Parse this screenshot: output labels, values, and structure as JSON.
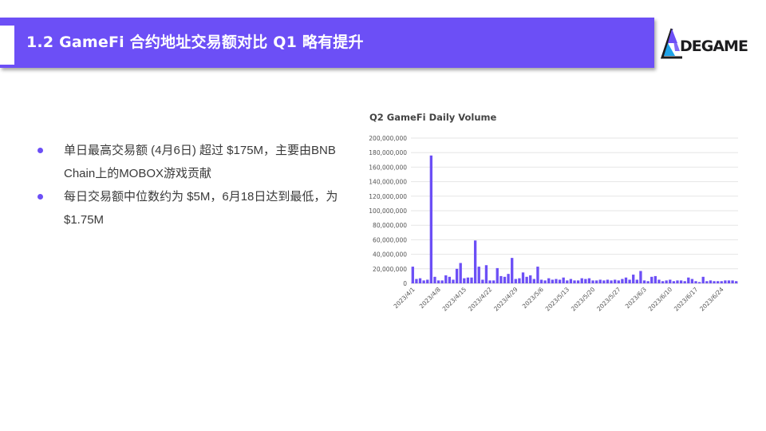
{
  "header": {
    "title": "1.2   GameFi 合约地址交易额对比 Q1 略有提升"
  },
  "logo": {
    "text": "DEGAME",
    "colors": {
      "purple": "#6c4ff6",
      "blue": "#1fa3e8",
      "dark": "#1d1d1f"
    }
  },
  "bullets": [
    "单日最高交易额 (4月6日) 超过 $175M，主要由BNB Chain上的MOBOX游戏贡献",
    "每日交易额中位数约为 $5M，6月18日达到最低，为 $1.75M"
  ],
  "colors": {
    "accent": "#6c4ff6",
    "bar": "#6c4ff6",
    "grid": "#e6e6e6"
  },
  "chart_data": {
    "type": "bar",
    "title": "Q2 GameFi Daily Volume",
    "x_tick_labels": [
      "2023/4/1",
      "2023/4/8",
      "2023/4/15",
      "2023/4/22",
      "2023/4/29",
      "2023/5/6",
      "2023/5/13",
      "2023/5/20",
      "2023/5/27",
      "2023/6/3",
      "2023/6/10",
      "2023/6/17",
      "2023/6/24"
    ],
    "x_tick_indices": [
      0,
      7,
      14,
      21,
      28,
      35,
      42,
      49,
      56,
      63,
      70,
      77,
      84
    ],
    "ylim": [
      0,
      200000000
    ],
    "yticks": [
      "0",
      "20,000,000",
      "40,000,000",
      "60,000,000",
      "80,000,000",
      "100,000,000",
      "120,000,000",
      "140,000,000",
      "160,000,000",
      "180,000,000",
      "200,000,000"
    ],
    "grid": true,
    "legend": "none",
    "values": [
      23000000,
      6000000,
      7000000,
      4000000,
      5000000,
      176000000,
      9000000,
      4000000,
      4000000,
      11000000,
      9000000,
      5000000,
      20000000,
      28000000,
      7000000,
      8000000,
      8000000,
      59000000,
      23000000,
      5000000,
      25000000,
      4000000,
      4000000,
      21000000,
      10000000,
      9000000,
      13000000,
      35000000,
      6000000,
      7000000,
      15000000,
      9000000,
      11000000,
      6000000,
      23000000,
      5000000,
      4000000,
      7000000,
      5000000,
      6000000,
      5000000,
      8000000,
      4000000,
      6000000,
      4000000,
      4000000,
      7000000,
      6000000,
      7000000,
      4000000,
      4000000,
      5000000,
      4000000,
      5000000,
      4000000,
      5000000,
      4000000,
      6000000,
      8000000,
      5000000,
      12000000,
      5000000,
      17000000,
      4000000,
      3000000,
      9000000,
      10000000,
      5000000,
      3000000,
      4000000,
      5000000,
      3000000,
      4000000,
      4000000,
      3000000,
      8000000,
      6000000,
      3000000,
      1750000,
      9000000,
      3000000,
      4000000,
      3000000,
      3000000,
      3000000,
      4000000,
      4000000,
      4000000,
      3000000
    ]
  }
}
